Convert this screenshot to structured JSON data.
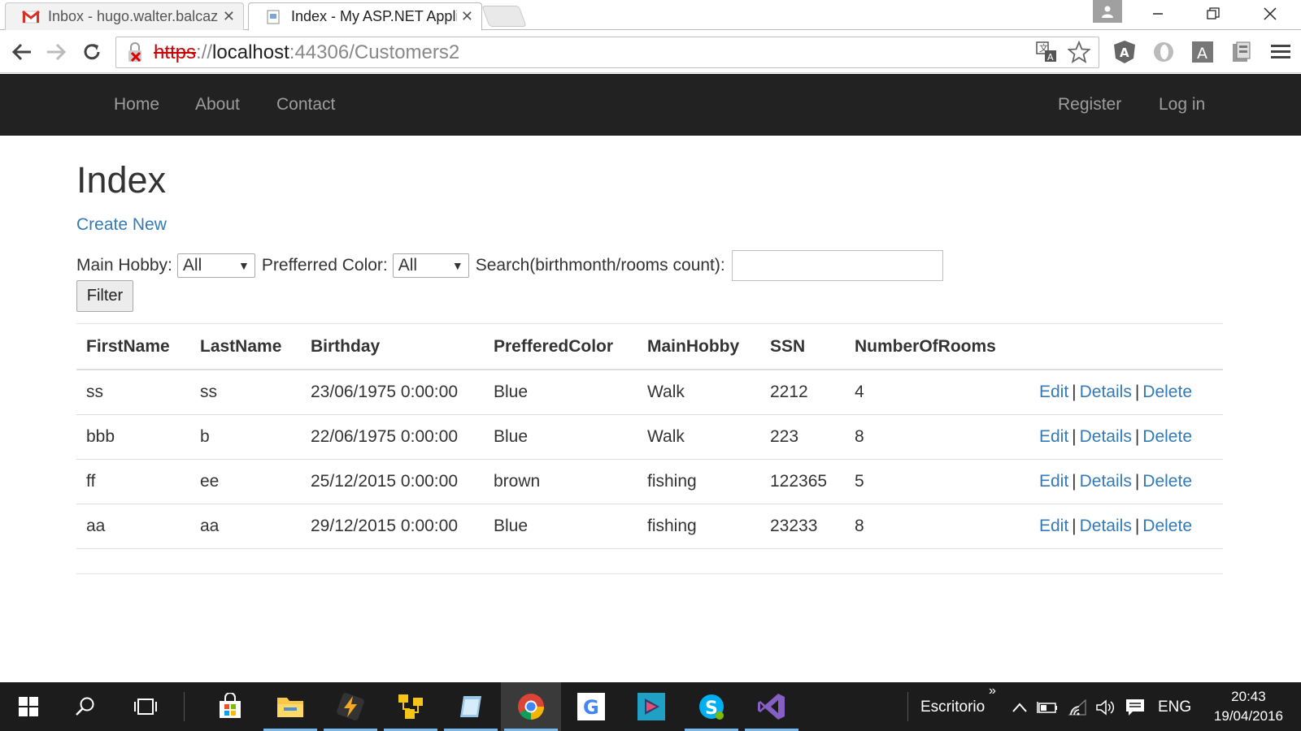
{
  "browser": {
    "tabs": [
      {
        "title": "Inbox - hugo.walter.balcaz",
        "active": false,
        "icon": "gmail-icon"
      },
      {
        "title": "Index - My ASP.NET Appli",
        "active": true,
        "icon": "page-icon"
      }
    ],
    "url": {
      "scheme": "https",
      "separator": "://",
      "host": "localhost",
      "path": ":44306/Customers2"
    }
  },
  "site_nav": {
    "left": [
      "Home",
      "About",
      "Contact"
    ],
    "right": [
      "Register",
      "Log in"
    ]
  },
  "page": {
    "title": "Index",
    "create_link": "Create New",
    "filters": {
      "hobby_label": "Main Hobby:",
      "hobby_value": "All",
      "color_label": "Prefferred Color:",
      "color_value": "All",
      "search_label": "Search(birthmonth/rooms count):",
      "search_value": "",
      "filter_button": "Filter"
    },
    "table": {
      "headers": [
        "FirstName",
        "LastName",
        "Birthday",
        "PrefferedColor",
        "MainHobby",
        "SSN",
        "NumberOfRooms"
      ],
      "rows": [
        [
          "ss",
          "ss",
          "23/06/1975 0:00:00",
          "Blue",
          "Walk",
          "2212",
          "4"
        ],
        [
          "bbb",
          "b",
          "22/06/1975 0:00:00",
          "Blue",
          "Walk",
          "223",
          "8"
        ],
        [
          "ff",
          "ee",
          "25/12/2015 0:00:00",
          "brown",
          "fishing",
          "122365",
          "5"
        ],
        [
          "aa",
          "aa",
          "29/12/2015 0:00:00",
          "Blue",
          "fishing",
          "23233",
          "8"
        ]
      ],
      "actions": {
        "edit": "Edit",
        "details": "Details",
        "delete": "Delete",
        "separator": "|"
      }
    }
  },
  "taskbar": {
    "desktop_label": "Escritorio",
    "language": "ENG",
    "time": "20:43",
    "date": "19/04/2016"
  },
  "colors": {
    "navbar_bg": "#222222",
    "link": "#337ab7",
    "taskbar_bg": "#1c1c1c"
  }
}
